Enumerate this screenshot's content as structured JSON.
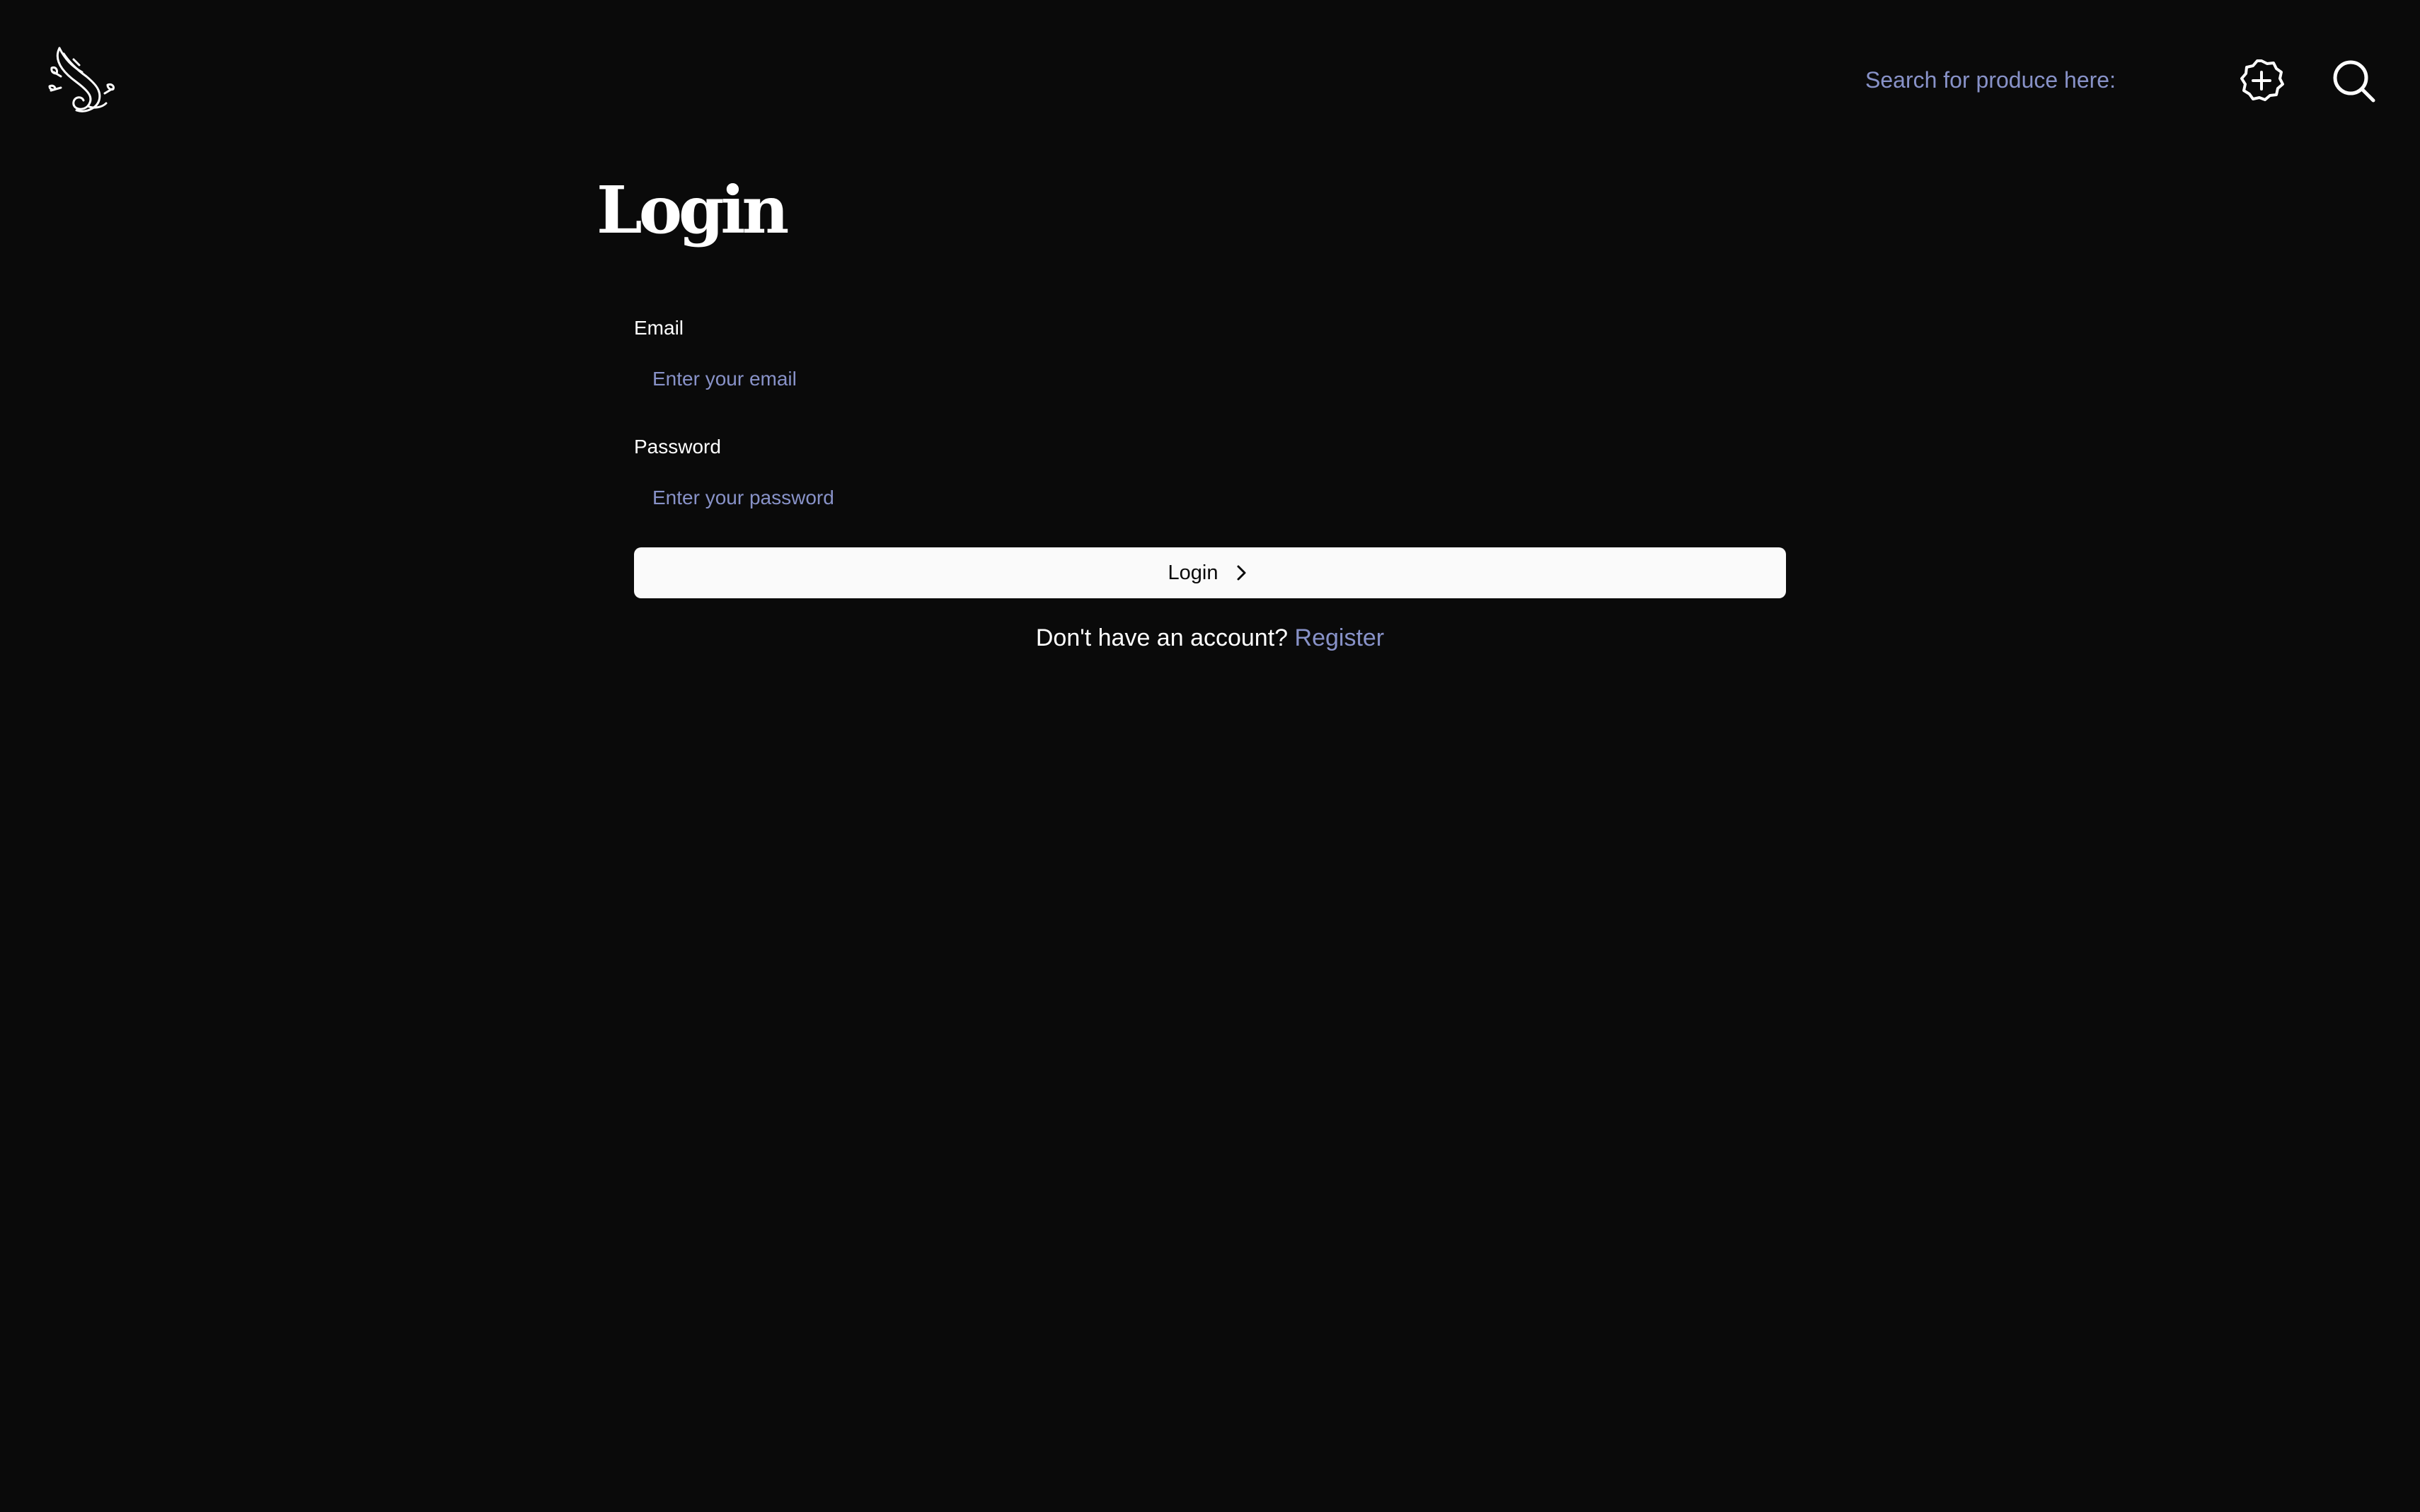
{
  "header": {
    "logo": "swan-logo",
    "search": {
      "placeholder": "Search for produce here:",
      "value": ""
    },
    "add_icon": "plus-badge-icon",
    "search_icon": "search-icon"
  },
  "page": {
    "title": "Login"
  },
  "form": {
    "email": {
      "label": "Email",
      "placeholder": "Enter your email",
      "value": ""
    },
    "password": {
      "label": "Password",
      "placeholder": "Enter your password",
      "value": ""
    },
    "submit": {
      "label": "Login",
      "icon": "chevron-right-icon"
    }
  },
  "footer_prompt": {
    "text": "Don't have an account?",
    "link_label": "Register"
  },
  "colors": {
    "background": "#0a0a0a",
    "text": "#ffffff",
    "accent": "#8892c8",
    "button_bg": "#fafafa",
    "button_text": "#0a0a0a"
  }
}
